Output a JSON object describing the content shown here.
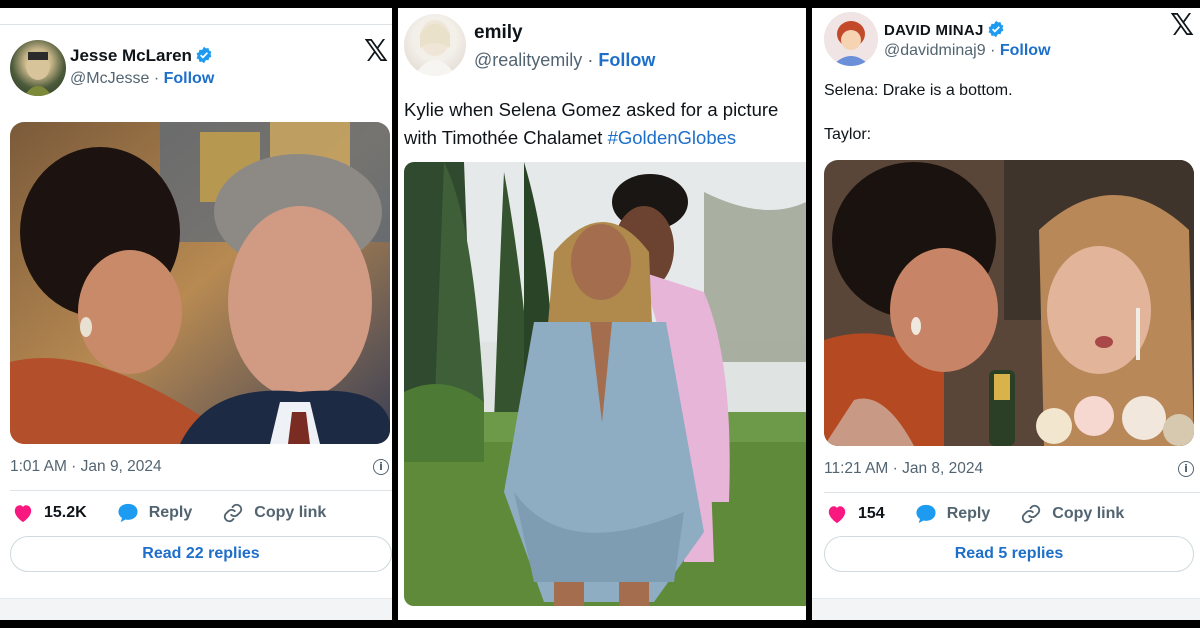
{
  "tweets": [
    {
      "name": "Jesse McLaren",
      "handle": "@McJesse",
      "follow": "Follow",
      "timestamp": "1:01 AM · Jan 9, 2024",
      "likes": "15.2K",
      "reply": "Reply",
      "copy": "Copy link",
      "replies_btn": "Read 22 replies"
    },
    {
      "name": "emily",
      "handle": "@realityemily",
      "follow": "Follow",
      "text_line1": "Kylie when Selena Gomez asked for a picture",
      "text_line2": "with Timothée Chalamet ",
      "hashtag": "#GoldenGlobes"
    },
    {
      "name": "DAVID MINAJ",
      "handle": "@davidminaj9",
      "follow": "Follow",
      "text_line1": "Selena: Drake is a bottom.",
      "text_line2": "Taylor:",
      "timestamp": "11:21 AM · Jan 8, 2024",
      "likes": "154",
      "reply": "Reply",
      "copy": "Copy link",
      "replies_btn": "Read 5 replies"
    }
  ],
  "separator": "·",
  "colors": {
    "accent": "#1d6fc9",
    "like": "#f91880",
    "verified": "#1d9bf0",
    "muted": "#536471"
  },
  "icons": [
    "verified-badge-icon",
    "x-logo-icon",
    "heart-icon",
    "reply-bubble-icon",
    "link-icon",
    "info-icon"
  ]
}
